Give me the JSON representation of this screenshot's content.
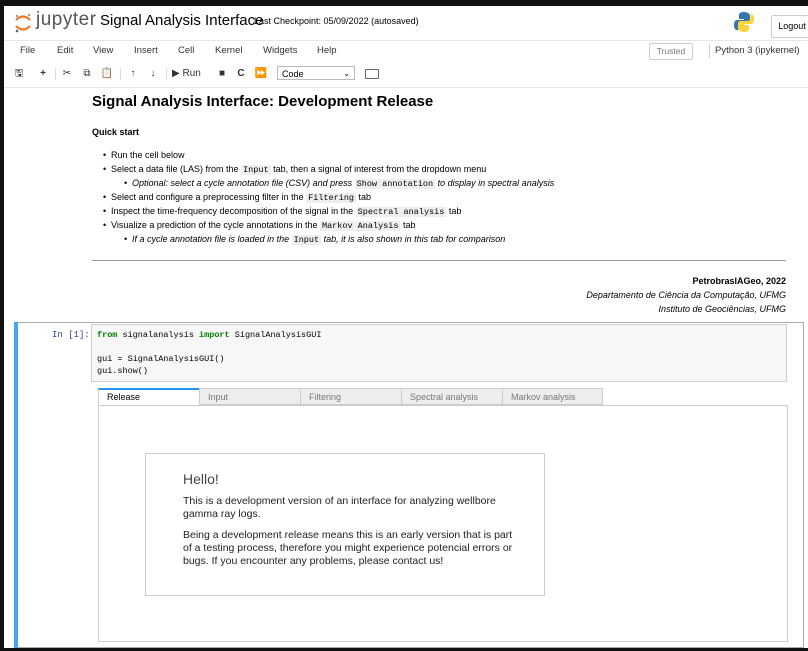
{
  "header": {
    "logo_text": "jupyter",
    "notebook_title": "Signal Analysis Interface",
    "checkpoint": "Last Checkpoint: 05/09/2022  (autosaved)",
    "logout_label": "Logout"
  },
  "menubar": {
    "items": [
      "File",
      "Edit",
      "View",
      "Insert",
      "Cell",
      "Kernel",
      "Widgets",
      "Help"
    ],
    "trusted": "Trusted",
    "kernel": "Python 3 (ipykernel)"
  },
  "toolbar": {
    "run_label": "Run",
    "cell_type": "Code"
  },
  "markdown": {
    "title": "Signal Analysis Interface: Development Release",
    "subtitle": "Quick start",
    "items": {
      "i1": "Run the cell below",
      "i2a": "Select a data file (LAS) from the ",
      "i2b": "Input",
      "i2c": " tab, then a signal of interest from the dropdown menu",
      "i3a": "Optional: select a cycle annotation file (CSV) and press ",
      "i3b": "Show annotation",
      "i3c": " to display in spectral analysis",
      "i4a": "Select and configure a preprocessing filter in the ",
      "i4b": "Filtering",
      "i4c": " tab",
      "i5a": "Inspect the time-frequency decomposition of the signal in the ",
      "i5b": "Spectral analysis",
      "i5c": " tab",
      "i6a": "Visualize a prediction of the cycle annotations in the ",
      "i6b": "Markov Analysis",
      "i6c": " tab",
      "i7a": "If a cycle annotation file is loaded in the ",
      "i7b": "Input",
      "i7c": " tab, it is also shown in this tab for comparison"
    },
    "author": "PetrobrasIAGeo, 2022",
    "dept": "Departamento de Ciência da Computação, UFMG",
    "inst": "Instituto de Geociências, UFMG"
  },
  "code_cell": {
    "prompt": "In [1]:",
    "line1_from": "from",
    "line1_mod": " signalanalysis ",
    "line1_import": "import",
    "line1_name": " SignalAnalysisGUI",
    "line2": "gui = SignalAnalysisGUI()",
    "line3": "gui.show()"
  },
  "widget": {
    "tabs": [
      "Release",
      "Input",
      "Filtering",
      "Spectral analysis",
      "Markov analysis"
    ],
    "active_tab": "Release",
    "hello_title": "Hello!",
    "hello_p1": "This is a development version of an interface for analyzing wellbore gamma ray logs.",
    "hello_p2": "Being a development release means this is an early version that is part of a testing process, therefore you might experience potencial errors or bugs. If you encounter any problems, please contact us!"
  },
  "colors": {
    "accent": "#2196f3",
    "cell_selected_bar": "#42a5f5",
    "jupyter_orange": "#f37626"
  }
}
